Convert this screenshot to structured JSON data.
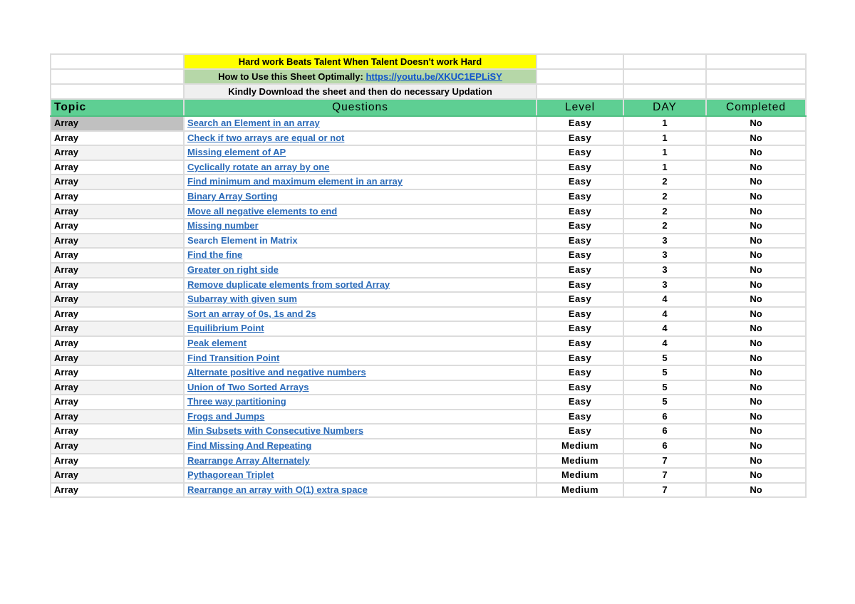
{
  "banner": {
    "motto": "Hard work Beats Talent When Talent Doesn't work Hard",
    "howto_label": "How to Use this Sheet Optimally: ",
    "howto_link": "https://youtu.be/XKUC1EPLiSY",
    "instruction": "Kindly Download the sheet and then do necessary Updation"
  },
  "colors": {
    "header_green": "#5ecf93",
    "motto_yellow": "#ffff00",
    "howto_sage": "#b6d7a8",
    "link_blue": "#2a6ab8"
  },
  "columns": [
    "Topic",
    "Questions",
    "Level",
    "DAY",
    "Completed"
  ],
  "rows": [
    {
      "topic": "Array",
      "question": "Search an Element in an array",
      "link": true,
      "level": "Easy",
      "day": "1",
      "completed": "No"
    },
    {
      "topic": "Array",
      "question": "Check if two arrays are equal or not",
      "link": true,
      "level": "Easy",
      "day": "1",
      "completed": "No"
    },
    {
      "topic": "Array",
      "question": "Missing element of AP",
      "link": true,
      "level": "Easy",
      "day": "1",
      "completed": "No"
    },
    {
      "topic": "Array",
      "question": "Cyclically rotate an array by one",
      "link": true,
      "level": "Easy",
      "day": "1",
      "completed": "No"
    },
    {
      "topic": "Array",
      "question": "Find minimum and maximum element in an array",
      "link": true,
      "level": "Easy",
      "day": "2",
      "completed": "No"
    },
    {
      "topic": "Array",
      "question": "Binary Array Sorting",
      "link": true,
      "level": "Easy",
      "day": "2",
      "completed": "No"
    },
    {
      "topic": "Array",
      "question": "Move all negative elements to end",
      "link": true,
      "level": "Easy",
      "day": "2",
      "completed": "No"
    },
    {
      "topic": "Array",
      "question": "Missing number",
      "link": true,
      "level": "Easy",
      "day": "2",
      "completed": "No"
    },
    {
      "topic": "Array",
      "question": "Search Element in Matrix",
      "link": false,
      "level": "Easy",
      "day": "3",
      "completed": "No"
    },
    {
      "topic": "Array",
      "question": "Find the fine",
      "link": true,
      "level": "Easy",
      "day": "3",
      "completed": "No"
    },
    {
      "topic": "Array",
      "question": "Greater on right side",
      "link": true,
      "level": "Easy",
      "day": "3",
      "completed": "No"
    },
    {
      "topic": "Array",
      "question": "Remove duplicate elements from sorted Array",
      "link": true,
      "level": "Easy",
      "day": "3",
      "completed": "No"
    },
    {
      "topic": "Array",
      "question": "Subarray with given sum",
      "link": true,
      "level": "Easy",
      "day": "4",
      "completed": "No"
    },
    {
      "topic": "Array",
      "question": "Sort an array of 0s, 1s and 2s",
      "link": true,
      "level": "Easy",
      "day": "4",
      "completed": "No"
    },
    {
      "topic": "Array",
      "question": "Equilibrium Point",
      "link": true,
      "level": "Easy",
      "day": "4",
      "completed": "No"
    },
    {
      "topic": "Array",
      "question": "Peak element",
      "link": true,
      "level": "Easy",
      "day": "4",
      "completed": "No"
    },
    {
      "topic": "Array",
      "question": "Find Transition Point",
      "link": true,
      "level": "Easy",
      "day": "5",
      "completed": "No"
    },
    {
      "topic": "Array",
      "question": "Alternate positive and negative numbers",
      "link": true,
      "level": "Easy",
      "day": "5",
      "completed": "No"
    },
    {
      "topic": "Array",
      "question": "Union of Two Sorted Arrays",
      "link": true,
      "level": "Easy",
      "day": "5",
      "completed": "No"
    },
    {
      "topic": "Array",
      "question": "Three way partitioning",
      "link": true,
      "level": "Easy",
      "day": "5",
      "completed": "No"
    },
    {
      "topic": "Array",
      "question": "Frogs and Jumps",
      "link": true,
      "level": "Easy",
      "day": "6",
      "completed": "No"
    },
    {
      "topic": "Array",
      "question": "Min Subsets with Consecutive Numbers",
      "link": true,
      "level": "Easy",
      "day": "6",
      "completed": "No"
    },
    {
      "topic": "Array",
      "question": "Find Missing And Repeating",
      "link": true,
      "level": "Medium",
      "day": "6",
      "completed": "No"
    },
    {
      "topic": "Array",
      "question": "Rearrange Array Alternately",
      "link": true,
      "level": "Medium",
      "day": "7",
      "completed": "No"
    },
    {
      "topic": "Array",
      "question": "Pythagorean Triplet",
      "link": true,
      "level": "Medium",
      "day": "7",
      "completed": "No"
    },
    {
      "topic": "Array",
      "question": "Rearrange an array with O(1) extra space",
      "link": true,
      "level": "Medium",
      "day": "7",
      "completed": "No"
    }
  ]
}
